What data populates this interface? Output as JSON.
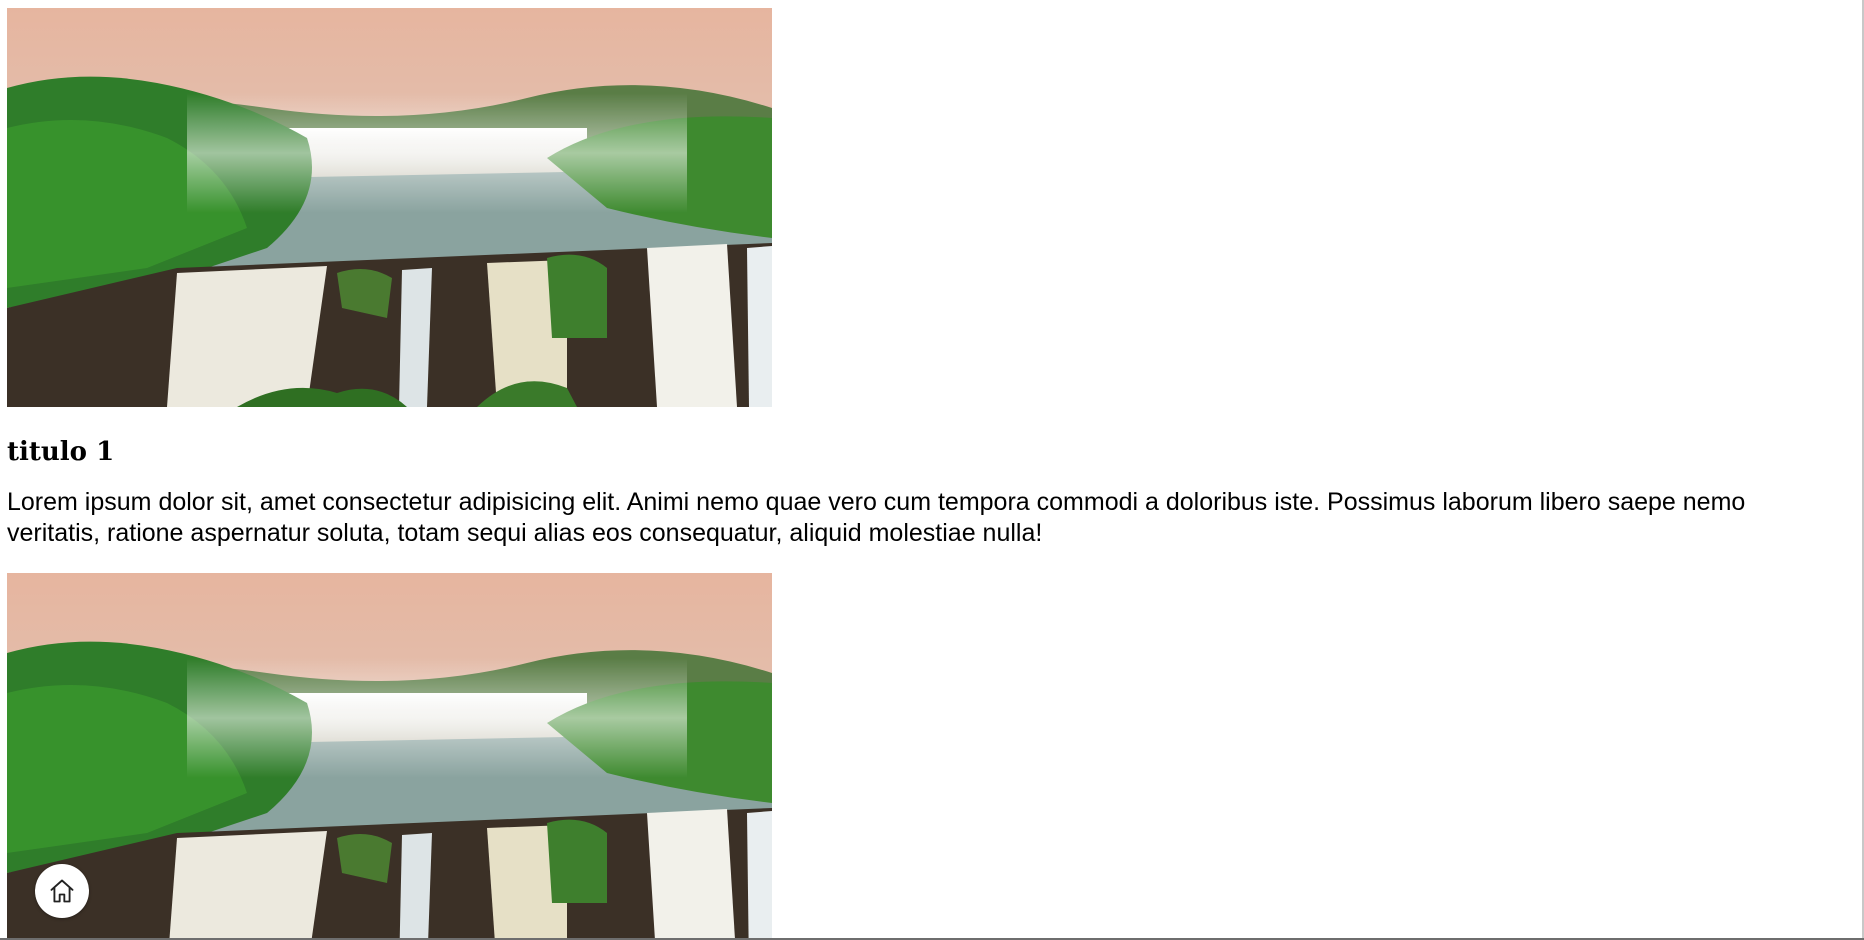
{
  "article": {
    "title": "titulo 1",
    "text": "Lorem ipsum dolor sit, amet consectetur adipisicing elit. Animi nemo quae vero cum tempora commodi a doloribus iste. Possimus laborum libero saepe nemo veritatis, ratione aspernatur soluta, totam sequi alias eos consequatur, aliquid molestiae nulla!"
  },
  "images": [
    {
      "icon": "waterfall-photo"
    },
    {
      "icon": "waterfall-photo"
    }
  ],
  "floating_button": {
    "icon": "home-icon"
  },
  "colors": {
    "sky_top": "#e8b9a3",
    "sky_bottom": "#d9cfc6",
    "foliage": "#2f7d2a",
    "water": "#f1f3f2",
    "rock": "#3b3026"
  }
}
